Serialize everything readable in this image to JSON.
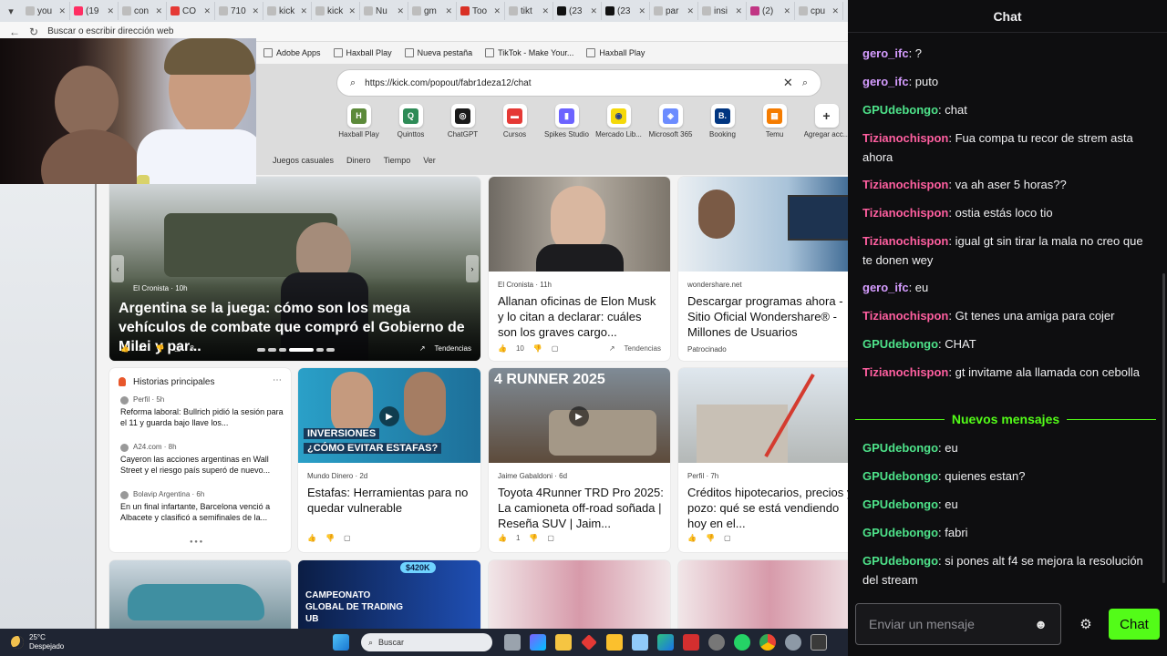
{
  "browser": {
    "tabs": [
      {
        "label": "you",
        "color": "#bdbdbd"
      },
      {
        "label": "(19",
        "color": "#ff2e63"
      },
      {
        "label": "con",
        "color": "#bdbdbd"
      },
      {
        "label": "CO",
        "color": "#e53935"
      },
      {
        "label": "710",
        "color": "#bdbdbd"
      },
      {
        "label": "kick",
        "color": "#bdbdbd"
      },
      {
        "label": "kick",
        "color": "#bdbdbd"
      },
      {
        "label": "Nu",
        "color": "#bdbdbd"
      },
      {
        "label": "gm",
        "color": "#bdbdbd"
      },
      {
        "label": "Too",
        "color": "#d93025"
      },
      {
        "label": "tikt",
        "color": "#bdbdbd"
      },
      {
        "label": "(23",
        "color": "#111111"
      },
      {
        "label": "(23",
        "color": "#111111"
      },
      {
        "label": "par",
        "color": "#bdbdbd"
      },
      {
        "label": "insi",
        "color": "#bdbdbd"
      },
      {
        "label": "(2)",
        "color": "#c13584"
      },
      {
        "label": "cpu",
        "color": "#bdbdbd"
      }
    ],
    "address_placeholder": "Buscar o escribir dirección web",
    "bookmarks": [
      "Adobe Apps",
      "Haxball Play",
      "Nueva pestaña",
      "TikTok - Make Your...",
      "Haxball Play"
    ],
    "ntp_search_value": "https://kick.com/popout/fabr1deza12/chat",
    "shortcuts": [
      {
        "label": "Haxball Play",
        "glyph": "H",
        "color": "#5c8a3a"
      },
      {
        "label": "Quinttos",
        "glyph": "Q",
        "color": "#2e8b57"
      },
      {
        "label": "ChatGPT",
        "glyph": "◎",
        "color": "#1a1a1a"
      },
      {
        "label": "Cursos",
        "glyph": "▬",
        "color": "#e53935"
      },
      {
        "label": "Spikes Studio",
        "glyph": "▮",
        "color": "#6c63ff"
      },
      {
        "label": "Mercado Lib...",
        "glyph": "◉",
        "color": "#f5d90a"
      },
      {
        "label": "Microsoft 365",
        "glyph": "◈",
        "color": "#6c8cff"
      },
      {
        "label": "Booking",
        "glyph": "B.",
        "color": "#003580"
      },
      {
        "label": "Temu",
        "glyph": "▦",
        "color": "#f57c00"
      },
      {
        "label": "Agregar acc...",
        "glyph": "+",
        "color": "#ffffff"
      }
    ],
    "feed_nav": [
      "Juegos casuales",
      "Dinero",
      "Tiempo",
      "Ver"
    ]
  },
  "feed": {
    "hero": {
      "source": "El Cronista · 10h",
      "title": "Argentina se la juega: cómo son los mega vehículos de combate que compró el Gobierno de Milei y par...",
      "likes": "22",
      "comments": "8",
      "trend": "Tendencias"
    },
    "card1": {
      "source": "El Cronista · 11h",
      "title": "Allanan oficinas de Elon Musk y lo citan a declarar: cuáles son los graves cargo...",
      "likes": "10",
      "trend": "Tendencias"
    },
    "card2": {
      "source": "wondershare.net",
      "title": "Descargar programas ahora - Sitio Oficial Wondershare® - Millones de Usuarios",
      "sponsored": "Patrocinado"
    },
    "top_stories": {
      "heading": "Historias principales",
      "items": [
        {
          "source": "Perfil · 5h",
          "text": "Reforma laboral: Bullrich pidió la sesión para el 11 y guarda bajo llave los..."
        },
        {
          "source": "A24.com · 8h",
          "text": "Cayeron las acciones argentinas en Wall Street y el riesgo país superó de nuevo..."
        },
        {
          "source": "Bolavip Argentina · 6h",
          "text": "En un final infartante, Barcelona venció a Albacete y clasificó a semifinales de la..."
        }
      ]
    },
    "card3": {
      "source": "Mundo Dinero · 2d",
      "title": "Estafas: Herramientas para no quedar vulnerable",
      "thumb_line1": "INVERSIONES",
      "thumb_line2": "¿CÓMO EVITAR ESTAFAS?"
    },
    "card4": {
      "source": "Jaime Gabaldoni · 6d",
      "title": "Toyota 4Runner TRD Pro 2025: La camioneta off-road soñada | Reseña SUV | Jaim...",
      "likes": "1",
      "thumb_text": "4 RUNNER 2025"
    },
    "card5": {
      "source": "Perfil · 7h",
      "title": "Créditos hipotecarios, precios y pozo: qué se está vendiendo hoy en el..."
    },
    "bottom_thumb_text": "CAMPEONATO GLOBAL DE TRADING UB",
    "bottom_thumb_badge": "$420K"
  },
  "taskbar": {
    "temperature": "25°C",
    "condition": "Despejado",
    "search_placeholder": "Buscar"
  },
  "chat": {
    "header": "Chat",
    "colors": {
      "gero": "#d59cff",
      "gpu": "#4ee38a",
      "tiziano": "#ff5fa0",
      "accent": "#53fc18"
    },
    "messages": [
      {
        "user": "gero_ifc",
        "text": ": ?",
        "color": "#d59cff"
      },
      {
        "user": "gero_ifc",
        "text": ": puto",
        "color": "#d59cff"
      },
      {
        "user": "GPUdebongo",
        "text": ": chat",
        "color": "#4ee38a"
      },
      {
        "user": "Tizianochispon",
        "text": ": Fua compa tu recor de strem asta ahora",
        "color": "#ff5fa0"
      },
      {
        "user": "Tizianochispon",
        "text": ": va ah aser 5 horas??",
        "color": "#ff5fa0"
      },
      {
        "user": "Tizianochispon",
        "text": ": ostia estás loco tio",
        "color": "#ff5fa0"
      },
      {
        "user": "Tizianochispon",
        "text": ": igual gt sin tirar la mala no creo que te donen wey",
        "color": "#ff5fa0"
      },
      {
        "user": "gero_ifc",
        "text": ": eu",
        "color": "#d59cff"
      },
      {
        "user": "Tizianochispon",
        "text": ": Gt tenes una amiga para cojer",
        "color": "#ff5fa0"
      },
      {
        "user": "GPUdebongo",
        "text": ": CHAT",
        "color": "#4ee38a"
      },
      {
        "user": "Tizianochispon",
        "text": ": gt invitame ala llamada con cebolla",
        "color": "#ff5fa0"
      },
      {
        "user": "GPUdebongo",
        "text": ": eu",
        "color": "#4ee38a"
      },
      {
        "user": "GPUdebongo",
        "text": ": quienes estan?",
        "color": "#4ee38a"
      },
      {
        "user": "GPUdebongo",
        "text": ": eu",
        "color": "#4ee38a"
      },
      {
        "user": "GPUdebongo",
        "text": ": fabri",
        "color": "#4ee38a"
      },
      {
        "user": "GPUdebongo",
        "text": ": si pones alt f4 se mejora la resolución del stream",
        "color": "#4ee38a"
      }
    ],
    "new_messages_label": "Nuevos mensajes",
    "input_placeholder": "Enviar un mensaje",
    "send_label": "Chat"
  }
}
